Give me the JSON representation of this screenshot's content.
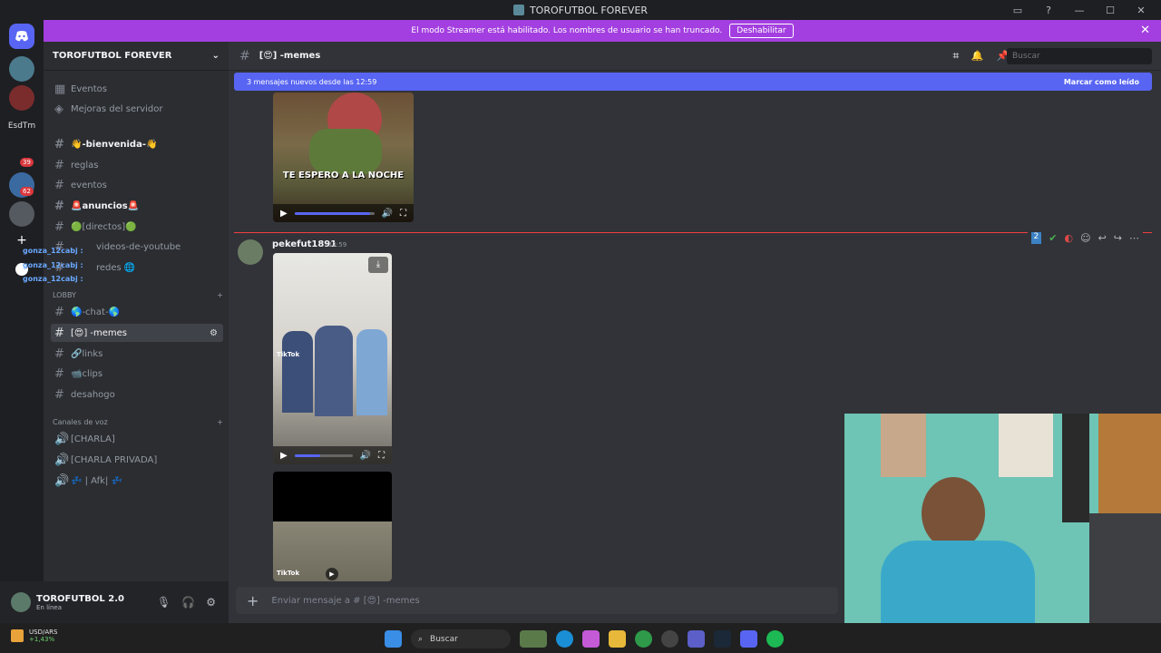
{
  "window": {
    "title": "TOROFUTBOL FOREVER",
    "controls": [
      "▭",
      "?",
      "—",
      "☐",
      "✕"
    ]
  },
  "streamer_bar": {
    "text": "El modo Streamer está habilitado. Los nombres de usuario se han truncado.",
    "button": "Deshabilitar",
    "close": "✕"
  },
  "guilds": {
    "label": "EsdTm",
    "badges": [
      "39",
      "62"
    ]
  },
  "server": {
    "name": "TOROFUTBOL FOREVER",
    "menu": [
      {
        "icon": "calendar-icon",
        "label": "Eventos"
      },
      {
        "icon": "boost-icon",
        "label": "Mejoras del servidor"
      }
    ],
    "channels_top": [
      {
        "label": "👋-bienvenida-👋",
        "bright": true
      },
      {
        "label": "reglas",
        "bright": false
      },
      {
        "label": "eventos",
        "bright": false
      },
      {
        "label": "🚨anuncios🚨",
        "bright": true
      },
      {
        "label": "🟢[directos]🟢",
        "bright": false
      },
      {
        "label": "videos-de-youtube",
        "bright": false
      },
      {
        "label": "redes 🌐",
        "bright": false
      }
    ],
    "overlay_names": [
      "gonza_12cabj :",
      "gonza_12cabj :",
      "gonza_12cabj :"
    ],
    "category_lobby": "LOBBY",
    "channels_lobby": [
      {
        "label": "🌎-chat-🌎"
      },
      {
        "label": "[😍] -memes",
        "active": true
      },
      {
        "label": "🔗links"
      },
      {
        "label": "📹clips"
      },
      {
        "label": "desahogo"
      }
    ],
    "category_voice": "Canales de voz",
    "voice_channels": [
      "[CHARLA]",
      "[CHARLA PRIVADA]",
      "💤 | Afk| 💤"
    ]
  },
  "user": {
    "name": "TOROFUTBOL 2.0",
    "status": "En línea"
  },
  "chat": {
    "channel": "[😍] -memes",
    "search_placeholder": "Buscar",
    "new_messages": "3 mensajes nuevos desde las 12:59",
    "mark_read": "Marcar como leído",
    "video1_caption": "TE ESPERO A LA NOCHE",
    "tiktok_label": "TikTok",
    "message": {
      "author": "pekefut1891",
      "time": "12:59"
    },
    "reaction_count": "2",
    "input_placeholder": "Enviar mensaje a # [😍] -memes"
  },
  "taskbar": {
    "ticker_name": "USD/ARS",
    "ticker_value": "+1,43%",
    "search": "Buscar"
  },
  "colors": {
    "accent": "#5865f2",
    "streamer": "#a33fe0",
    "sidebar": "#2b2d31",
    "chat": "#313338"
  }
}
